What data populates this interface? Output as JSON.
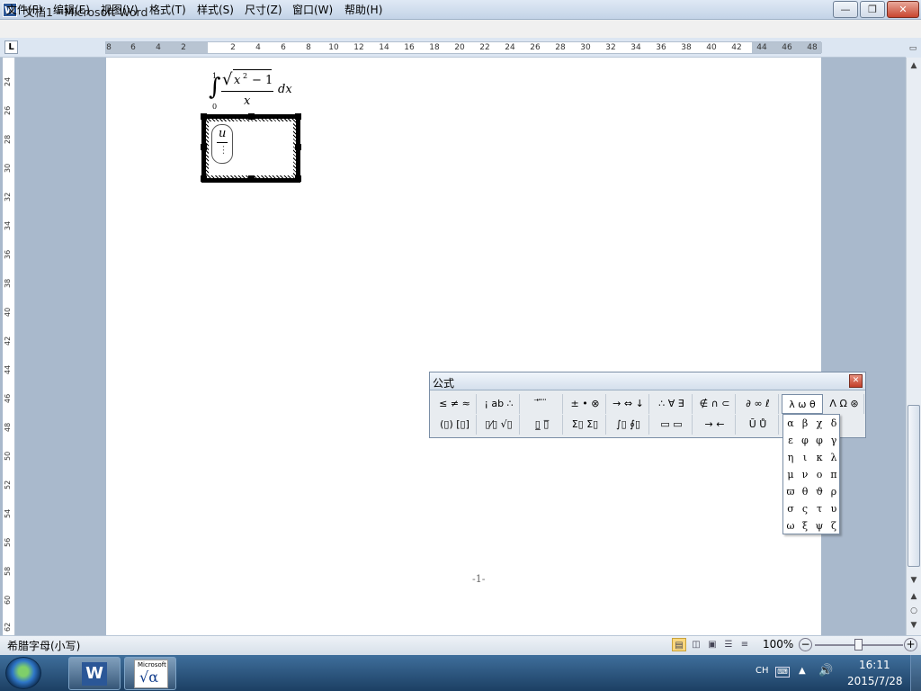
{
  "window": {
    "title": "文档1 - Microsoft Word",
    "app_icon": "W",
    "min": "—",
    "max": "❐",
    "close": "✕"
  },
  "menu": [
    "文件(F)",
    "编辑(E)",
    "视图(V)",
    "格式(T)",
    "样式(S)",
    "尺寸(Z)",
    "窗口(W)",
    "帮助(H)"
  ],
  "ruler": {
    "tab_selector": "L",
    "h_left": [
      "8",
      "6",
      "4",
      "2"
    ],
    "h_right": [
      "2",
      "4",
      "6",
      "8",
      "10",
      "12",
      "14",
      "16",
      "18",
      "20",
      "22",
      "24",
      "26",
      "28",
      "30",
      "32",
      "34",
      "36",
      "38",
      "40",
      "42",
      "44",
      "46",
      "48"
    ],
    "v": [
      "24",
      "26",
      "28",
      "30",
      "32",
      "34",
      "36",
      "38",
      "40",
      "42",
      "44",
      "46",
      "48",
      "50",
      "52",
      "54",
      "56",
      "58",
      "60",
      "62"
    ]
  },
  "document": {
    "formula": {
      "upper_limit": "1",
      "lower_limit": "0",
      "integral": "∫",
      "sqrt": "√",
      "radicand": "x",
      "exponent": "2",
      "minus_one": "− 1",
      "denominator": "x",
      "differential": "dx"
    },
    "editing_box": {
      "top": "u",
      "bottom": "⋮"
    },
    "page_number": "-1-"
  },
  "equation_toolbar": {
    "title": "公式",
    "close": "✕",
    "row1": [
      "≤ ≠ ≈",
      "¡ ab ∴",
      "⃗ ⃛ ⃜",
      "± • ⊗",
      "→ ⇔ ↓",
      "∴ ∀ ∃",
      "∉ ∩ ⊂",
      "∂ ∞ ℓ",
      "λ ω θ",
      "Λ Ω ⊛"
    ],
    "row2": [
      "(▯) [▯]",
      "▯⁄▯ √▯",
      "▯̲ ▯̅",
      "Σ▯ Σ▯",
      "∫▯ ∮▯",
      "▭ ▭",
      "→ ←",
      "Ū Ů"
    ]
  },
  "greek_palette": [
    "α",
    "β",
    "χ",
    "δ",
    "ε",
    "φ",
    "φ",
    "γ",
    "η",
    "ι",
    "κ",
    "λ",
    "μ",
    "ν",
    "ο",
    "π",
    "ϖ",
    "θ",
    "ϑ",
    "ρ",
    "σ",
    "ς",
    "τ",
    "υ",
    "ω",
    "ξ",
    "ψ",
    "ζ"
  ],
  "scrollbar": {
    "up": "▲",
    "down": "▼",
    "prev": "▲",
    "browse": "○",
    "next": "▼",
    "split": "▭"
  },
  "status": {
    "text": "希腊字母(小写)",
    "zoom": "100%",
    "zoom_minus": "−",
    "zoom_plus": "+"
  },
  "taskbar": {
    "word": "W",
    "eq_brand": "Microsoft",
    "eq_symbol": "√α",
    "lang": "CH",
    "kb": "⌨",
    "up": "▲",
    "vol": "🔊",
    "time": "16:11",
    "date": "2015/7/28"
  }
}
